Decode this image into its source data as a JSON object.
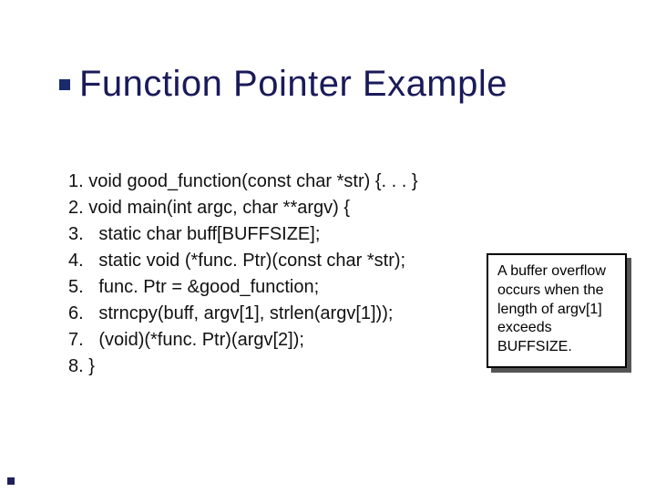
{
  "title": "Function Pointer Example",
  "code": {
    "lines": [
      "1. void good_function(const char *str) {. . . }",
      "2. void main(int argc, char **argv) {",
      "3.   static char buff[BUFFSIZE];",
      "4.   static void (*func. Ptr)(const char *str);",
      "5.   func. Ptr = &good_function;",
      "6.   strncpy(buff, argv[1], strlen(argv[1]));",
      "7.   (void)(*func. Ptr)(argv[2]);",
      "8. }"
    ]
  },
  "callout": {
    "text": "A buffer overflow occurs when the length of argv[1] exceeds BUFFSIZE."
  }
}
